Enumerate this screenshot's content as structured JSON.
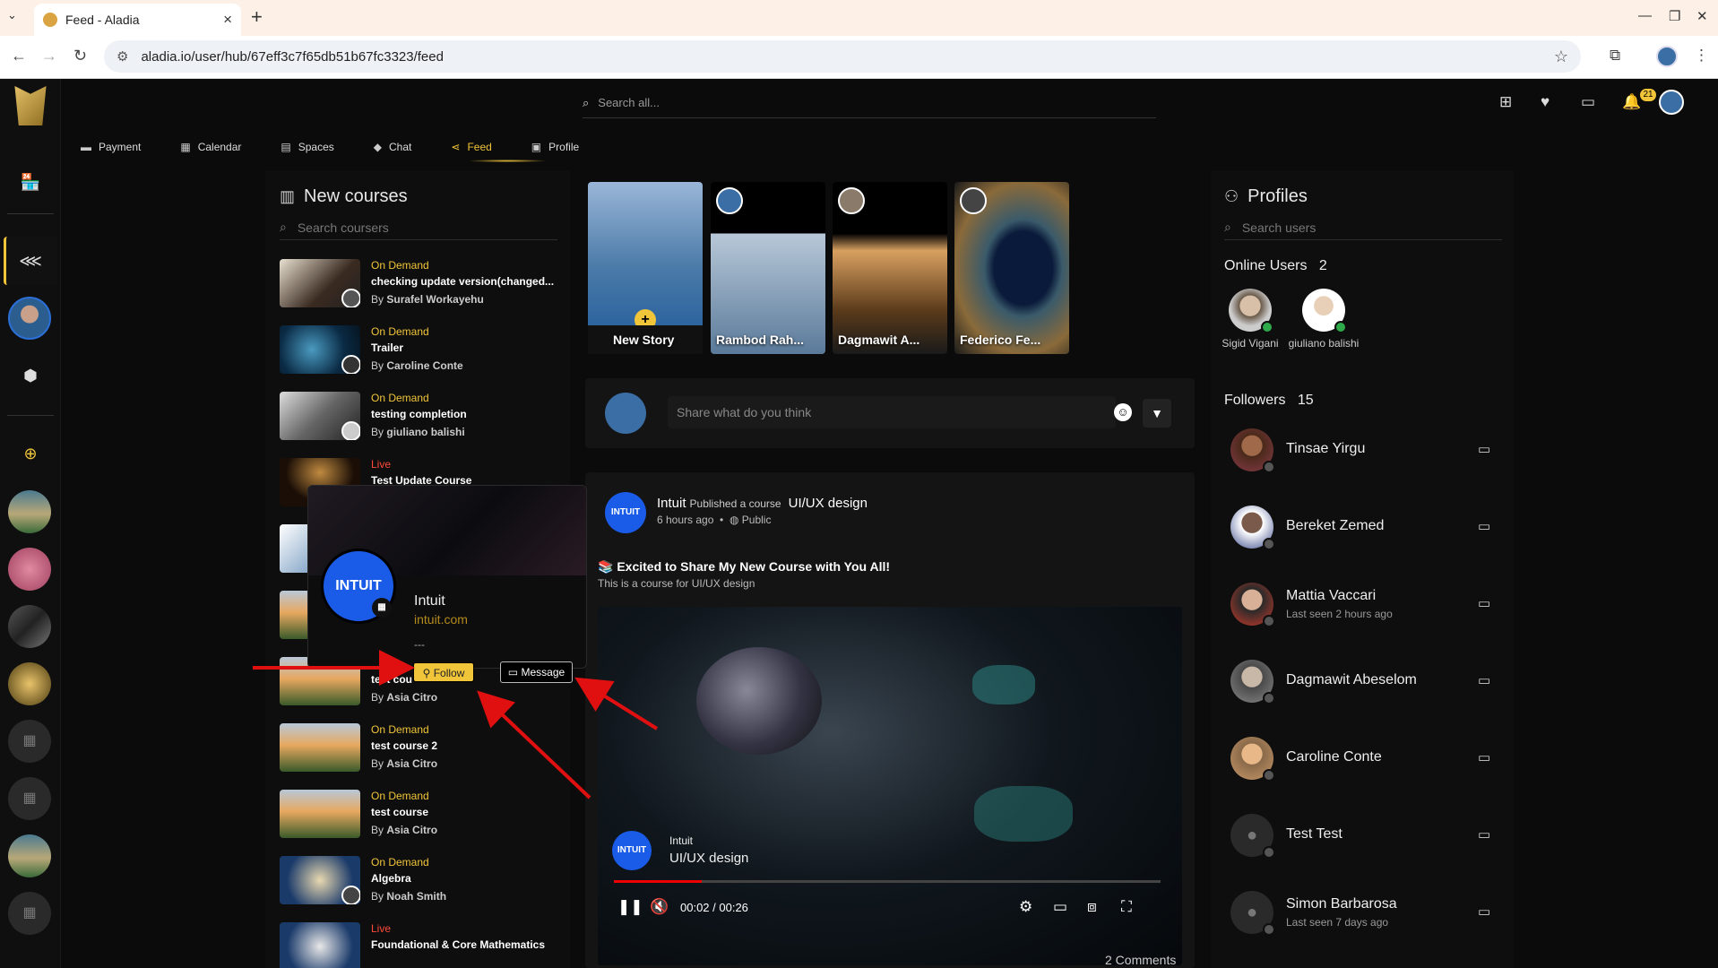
{
  "browser": {
    "tab_title": "Feed - Aladia",
    "url": "aladia.io/user/hub/67eff3c7f65db51b67fc3323/feed"
  },
  "nav": {
    "items": [
      {
        "label": "Payment",
        "icon": "wallet-icon"
      },
      {
        "label": "Calendar",
        "icon": "calendar-icon"
      },
      {
        "label": "Spaces",
        "icon": "spaces-icon"
      },
      {
        "label": "Chat",
        "icon": "chat-icon"
      },
      {
        "label": "Feed",
        "icon": "share-icon",
        "active": true
      },
      {
        "label": "Profile",
        "icon": "profile-card-icon"
      }
    ],
    "search_placeholder": "Search all...",
    "notifications_count": "21"
  },
  "courses": {
    "title": "New courses",
    "search_placeholder": "Search coursers",
    "items": [
      {
        "kind": "On Demand",
        "title": "checking update version(changed...",
        "by": "Surafel Workayehu"
      },
      {
        "kind": "On Demand",
        "title": "Trailer",
        "by": "Caroline Conte"
      },
      {
        "kind": "On Demand",
        "title": "testing completion",
        "by": "giuliano balishi"
      },
      {
        "kind": "Live",
        "title": "Test Update Course",
        "by": ""
      },
      {
        "kind": "",
        "title": "",
        "by": ""
      },
      {
        "kind": "",
        "title": "",
        "by": ""
      },
      {
        "kind": "",
        "title": "test cou",
        "by": "Asia Citro"
      },
      {
        "kind": "On Demand",
        "title": "test course 2",
        "by": "Asia Citro"
      },
      {
        "kind": "On Demand",
        "title": "test course",
        "by": "Asia Citro"
      },
      {
        "kind": "On Demand",
        "title": "Algebra",
        "by": "Noah Smith"
      },
      {
        "kind": "Live",
        "title": "Foundational & Core Mathematics",
        "by": ""
      }
    ],
    "by_prefix": "By"
  },
  "stories": [
    {
      "name": "New Story"
    },
    {
      "name": "Rambod Rah..."
    },
    {
      "name": "Dagmawit A..."
    },
    {
      "name": "Federico Fe..."
    }
  ],
  "composer": {
    "placeholder": "Share what do you think"
  },
  "post": {
    "author": "Intuit",
    "action": "Published a course",
    "course": "UI/UX design",
    "time": "6 hours ago",
    "visibility": "Public",
    "headline": "📚 Excited to Share My New Course with You All!",
    "description": "This is a course for UI/UX design",
    "video": {
      "owner": "Intuit",
      "course": "UI/UX design",
      "time": "00:02 / 00:26",
      "progress": 0.16
    },
    "comments": "2 Comments",
    "avatar_text": "INTUIT"
  },
  "popup": {
    "name": "Intuit",
    "url": "intuit.com",
    "dash": "---",
    "follow": "Follow",
    "message": "Message",
    "avatar_text": "INTUIT"
  },
  "profiles": {
    "title": "Profiles",
    "search_placeholder": "Search users",
    "online_label": "Online Users",
    "online_count": "2",
    "online": [
      {
        "name": "Sigid Vigani"
      },
      {
        "name": "giuliano balishi"
      }
    ],
    "followers_label": "Followers",
    "followers_count": "15",
    "followers": [
      {
        "name": "Tinsae Yirgu",
        "last_seen": ""
      },
      {
        "name": "Bereket Zemed",
        "last_seen": ""
      },
      {
        "name": "Mattia Vaccari",
        "last_seen": "Last seen 2 hours ago"
      },
      {
        "name": "Dagmawit Abeselom",
        "last_seen": ""
      },
      {
        "name": "Caroline Conte",
        "last_seen": ""
      },
      {
        "name": "Test Test",
        "last_seen": ""
      },
      {
        "name": "Simon Barbarosa",
        "last_seen": "Last seen 7 days ago"
      }
    ]
  },
  "colors": {
    "accent": "#f0c53a",
    "live": "#ff4a3a",
    "online": "#2faa4a"
  }
}
